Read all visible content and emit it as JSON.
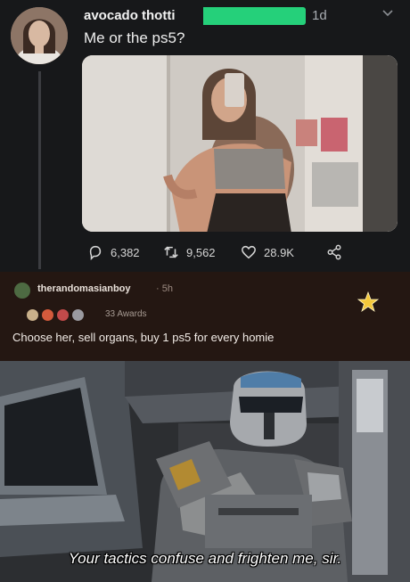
{
  "tweet": {
    "display_name": "avocado thotti",
    "timestamp": "1d",
    "text": "Me or the ps5?",
    "stats": {
      "replies": "6,382",
      "retweets": "9,562",
      "likes": "28.9K"
    }
  },
  "comment": {
    "username": "therandomasianboy",
    "time": "· 5h",
    "awards_count": "33 Awards",
    "text": "Choose her, sell organs, buy 1 ps5 for every homie"
  },
  "meme": {
    "caption": "Your tactics confuse and frighten me, sir."
  },
  "colors": {
    "tweet_bg": "#17181a",
    "redaction": "#25d07a",
    "comment_bg": "#241712",
    "award_star": "#f3c83a"
  }
}
